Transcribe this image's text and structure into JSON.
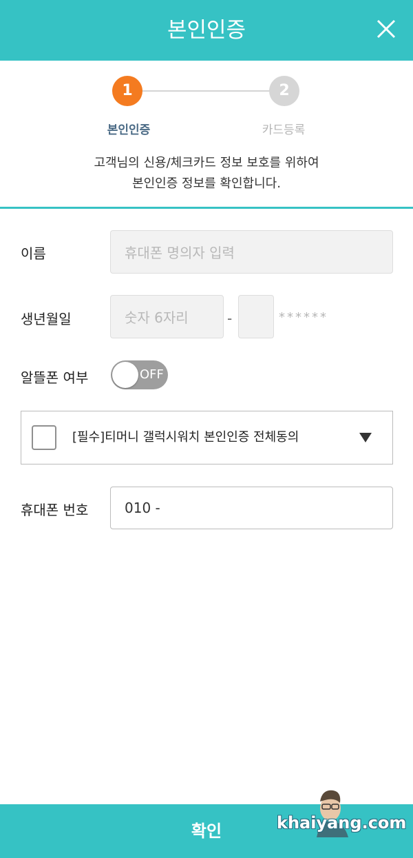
{
  "header": {
    "title": "본인인증",
    "close_icon": "close-icon"
  },
  "steps": {
    "items": [
      {
        "number": "1",
        "label": "본인인증",
        "active": true,
        "color": "#f47b20"
      },
      {
        "number": "2",
        "label": "카드등록",
        "active": false,
        "color": "#d6d6d6"
      }
    ],
    "description_line1": "고객님의 신용/체크카드 정보 보호를 위하여",
    "description_line2": "본인인증 정보를 확인합니다."
  },
  "form": {
    "name": {
      "label": "이름",
      "placeholder": "휴대폰 명의자 입력"
    },
    "birth": {
      "label": "생년월일",
      "placeholder": "숫자 6자리",
      "separator": "-",
      "mask": "******"
    },
    "mvno": {
      "label": "알뜰폰 여부",
      "toggle_text": "OFF",
      "value": false
    },
    "agreement": {
      "label": "[필수]티머니 갤럭시워치 본인인증 전체동의",
      "checked": false,
      "dropdown_icon": "triangle-down-icon"
    },
    "phone": {
      "label": "휴대폰 번호",
      "value": "010 -"
    }
  },
  "footer": {
    "confirm_label": "확인"
  },
  "watermark": {
    "text": "khaiyang.com"
  },
  "colors": {
    "accent": "#36c2c4",
    "step_active": "#f47b20",
    "toggle_off": "#9e9e9e"
  }
}
